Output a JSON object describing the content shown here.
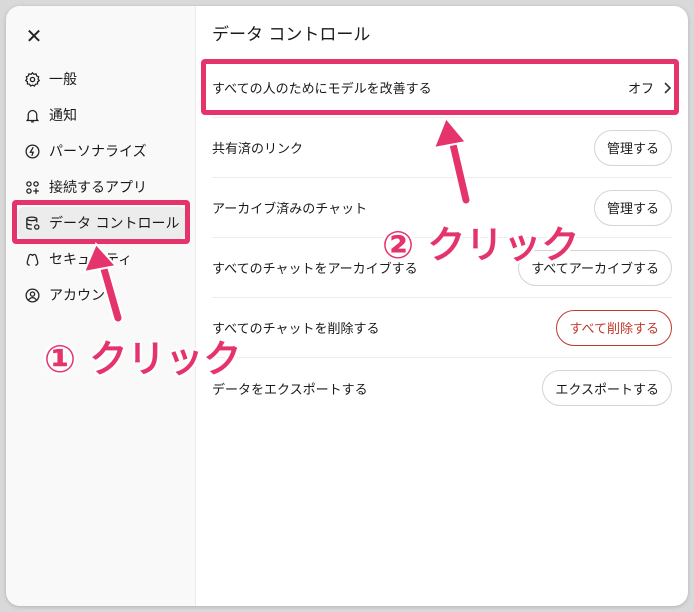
{
  "sidebar": {
    "close_icon": "✕",
    "items": [
      {
        "label": "一般",
        "icon": "gear-icon"
      },
      {
        "label": "通知",
        "icon": "bell-icon"
      },
      {
        "label": "パーソナライズ",
        "icon": "personalize-icon"
      },
      {
        "label": "接続するアプリ",
        "icon": "apps-icon"
      },
      {
        "label": "データ コントロール",
        "icon": "database-icon",
        "active": true
      },
      {
        "label": "セキュリティ",
        "icon": "security-icon"
      },
      {
        "label": "アカウント",
        "icon": "account-icon"
      }
    ]
  },
  "main": {
    "title": "データ コントロール",
    "rows": [
      {
        "label": "すべての人のためにモデルを改善する",
        "value": "オフ",
        "control": "toggle"
      },
      {
        "label": "共有済のリンク",
        "button": "管理する"
      },
      {
        "label": "アーカイブ済みのチャット",
        "button": "管理する"
      },
      {
        "label": "すべてのチャットをアーカイブする",
        "button": "すべてアーカイブする"
      },
      {
        "label": "すべてのチャットを削除する",
        "button": "すべて削除する",
        "danger": true
      },
      {
        "label": "データをエクスポートする",
        "button": "エクスポートする"
      }
    ]
  },
  "annotations": {
    "callout1": "① クリック",
    "callout2": "② クリック",
    "color": "#e5336b"
  }
}
